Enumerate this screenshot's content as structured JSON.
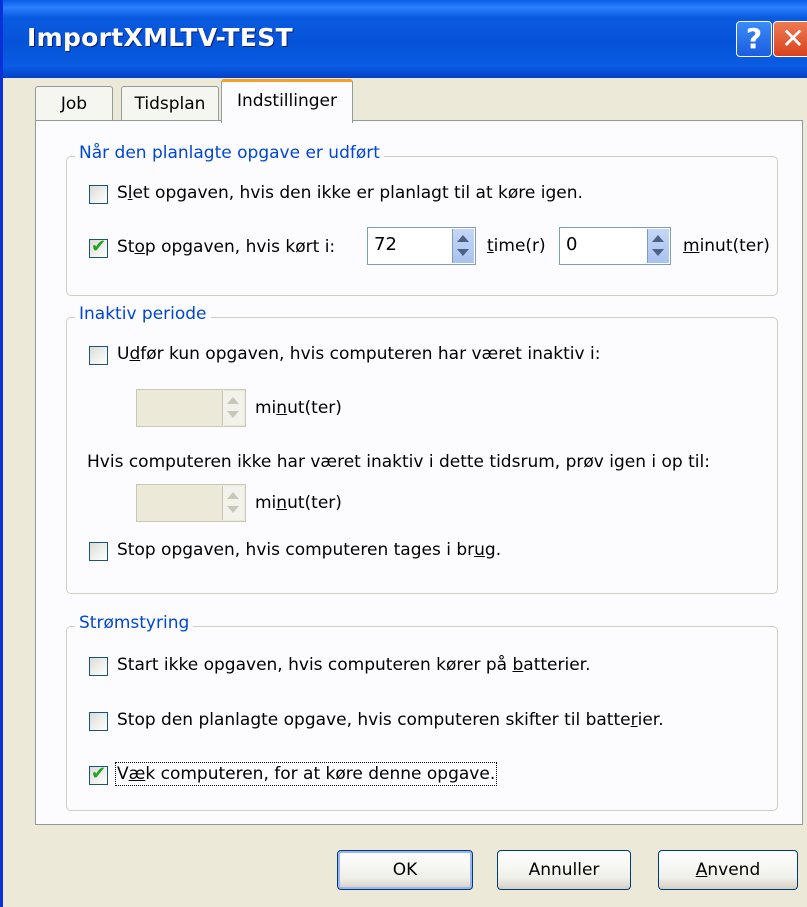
{
  "window": {
    "title": "ImportXMLTV-TEST",
    "help_glyph": "?",
    "close_glyph": "✕"
  },
  "tabs": [
    {
      "label": "Job"
    },
    {
      "label": "Tidsplan"
    },
    {
      "label": "Indstillinger",
      "active": true
    }
  ],
  "groups": {
    "completed": {
      "title": "Når den planlagte opgave er udført",
      "delete_task": {
        "label_a": "S",
        "label_u": "l",
        "label_b": "et opgaven, hvis den ikke er planlagt til at køre igen.",
        "checked": false
      },
      "stop_task": {
        "label_a": "St",
        "label_u": "o",
        "label_b": "p opgaven, hvis kørt i:",
        "checked": true
      },
      "hours_value": "72",
      "hours_label_u": "t",
      "hours_label_rest": "ime(r)",
      "minutes_value": "0",
      "minutes_label_u": "m",
      "minutes_label_rest": "inut(ter)"
    },
    "idle": {
      "title": "Inaktiv periode",
      "only_idle": {
        "label_a": "U",
        "label_u": "d",
        "label_b": "før kun opgaven, hvis computeren har været inaktiv i:",
        "checked": false
      },
      "idle_minutes_value": "",
      "idle_minutes_label_a": "mi",
      "idle_minutes_label_u": "n",
      "idle_minutes_label_b": "ut(ter)",
      "retry_text": "Hvis computeren ikke har været inaktiv i dette tidsrum, prøv igen i op til:",
      "retry_minutes_value": "",
      "retry_minutes_label_a": "mi",
      "retry_minutes_label_u": "n",
      "retry_minutes_label_b": "ut(ter)",
      "stop_in_use": {
        "label_a": "Stop opgaven, hvis computeren tages i br",
        "label_u": "u",
        "label_b": "g.",
        "checked": false
      }
    },
    "power": {
      "title": "Strømstyring",
      "no_start_battery": {
        "label_a": "Start ikke opgaven, hvis computeren kører på ",
        "label_u": "b",
        "label_b": "atterier.",
        "checked": false
      },
      "stop_battery": {
        "label_a": "Stop den planlagte opgave, hvis computeren skifter til batte",
        "label_u": "r",
        "label_b": "ier.",
        "checked": false
      },
      "wake": {
        "label_a": "V",
        "label_u": "æ",
        "label_b": "k computeren, for at køre denne opgave.",
        "checked": true
      }
    }
  },
  "buttons": {
    "ok": "OK",
    "cancel": "Annuller",
    "apply_u": "A",
    "apply_rest": "nvend"
  },
  "check_glyph": "✔",
  "colors": {
    "title_bar": "#0553D8",
    "group_title": "#0046D5",
    "dialog_bg": "#ECE9D8",
    "check": "#21A121",
    "active_tab_top": "#F4A12C"
  }
}
